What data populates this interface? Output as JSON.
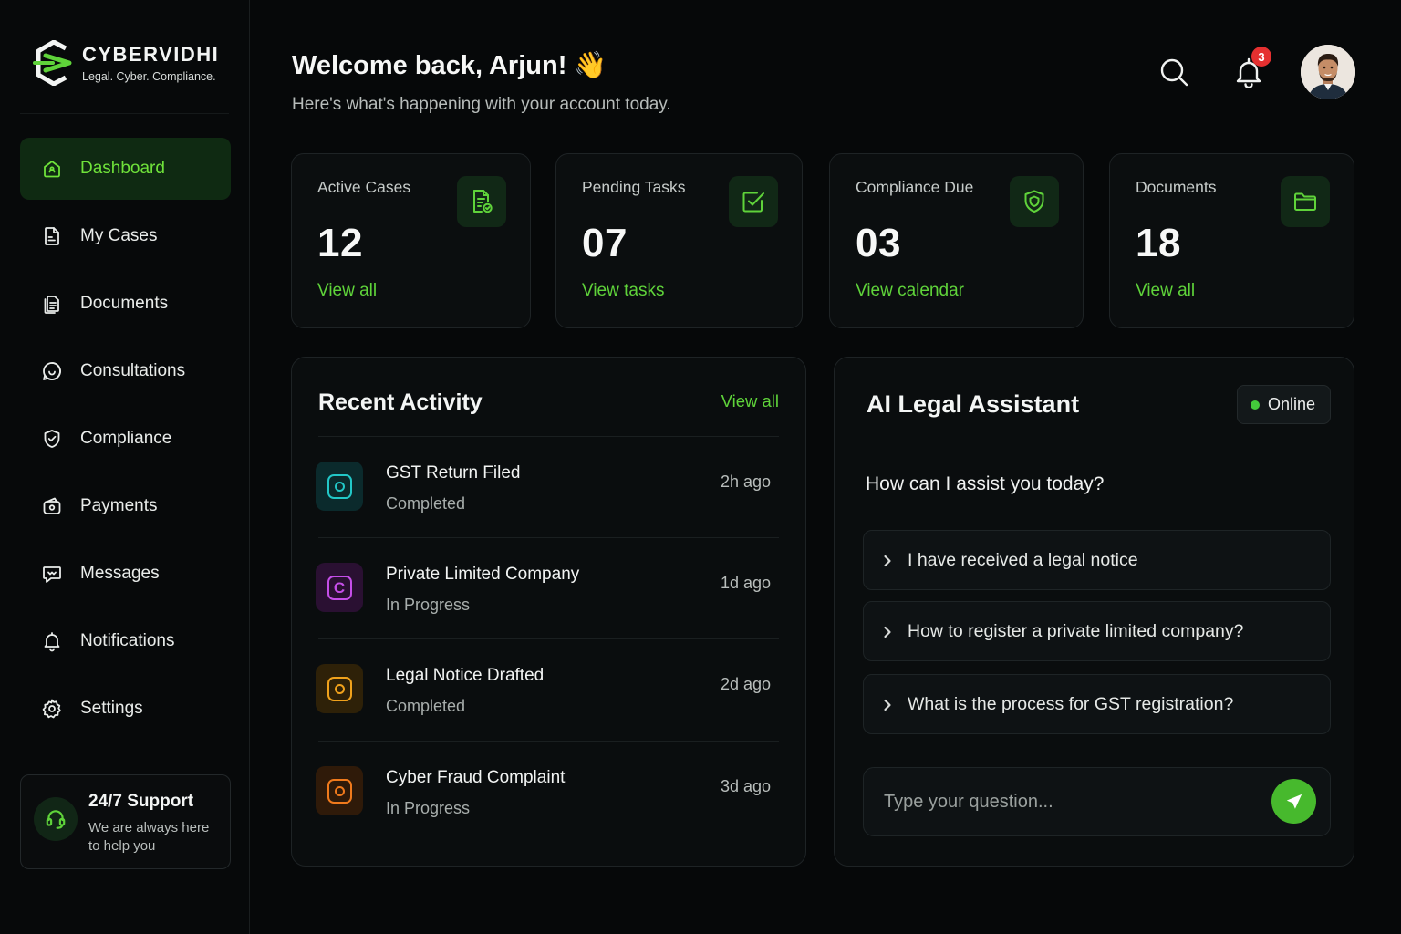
{
  "brand": {
    "name": "CYBERVIDHI",
    "tagline": "Legal. Cyber. Compliance."
  },
  "sidebar": {
    "items": [
      {
        "label": "Dashboard",
        "icon": "home-icon",
        "active": true
      },
      {
        "label": "My Cases",
        "icon": "case-file-icon"
      },
      {
        "label": "Documents",
        "icon": "documents-icon"
      },
      {
        "label": "Consultations",
        "icon": "consultation-icon"
      },
      {
        "label": "Compliance",
        "icon": "shield-check-icon"
      },
      {
        "label": "Payments",
        "icon": "wallet-icon"
      },
      {
        "label": "Messages",
        "icon": "message-icon"
      },
      {
        "label": "Notifications",
        "icon": "bell-icon"
      },
      {
        "label": "Settings",
        "icon": "gear-icon"
      }
    ],
    "support": {
      "title": "24/7 Support",
      "text": "We are always here to help you"
    }
  },
  "header": {
    "welcome": "Welcome back, Arjun! 👋",
    "subtitle": "Here's what's happening with your account today.",
    "notification_count": "3"
  },
  "stats": [
    {
      "label": "Active Cases",
      "value": "12",
      "link": "View all",
      "icon": "document-check-icon"
    },
    {
      "label": "Pending Tasks",
      "value": "07",
      "link": "View tasks",
      "icon": "checkbox-icon"
    },
    {
      "label": "Compliance Due",
      "value": "03",
      "link": "View calendar",
      "icon": "shield-icon"
    },
    {
      "label": "Documents",
      "value": "18",
      "link": "View all",
      "icon": "folder-icon"
    }
  ],
  "activity": {
    "title": "Recent Activity",
    "view_all": "View all",
    "items": [
      {
        "title": "GST Return Filed",
        "status": "Completed",
        "time": "2h ago",
        "color": "#22c7c7"
      },
      {
        "title": "Private Limited Company",
        "status": "In Progress",
        "time": "1d ago",
        "color": "#c54ee8"
      },
      {
        "title": "Legal Notice Drafted",
        "status": "Completed",
        "time": "2d ago",
        "color": "#f0a21c"
      },
      {
        "title": "Cyber Fraud Complaint",
        "status": "In Progress",
        "time": "3d ago",
        "color": "#f07a1c"
      }
    ]
  },
  "assistant": {
    "title": "AI Legal Assistant",
    "status": "Online",
    "question": "How can I assist you today?",
    "suggestions": [
      "I have received a legal notice",
      "How to register a private limited company?",
      "What is the process for GST registration?"
    ],
    "input_placeholder": "Type your question..."
  },
  "colors": {
    "accent": "#5fd33a",
    "background": "#060809",
    "card": "#0b0e0f",
    "active_nav": "#0f2a12",
    "badge": "#e53030"
  }
}
